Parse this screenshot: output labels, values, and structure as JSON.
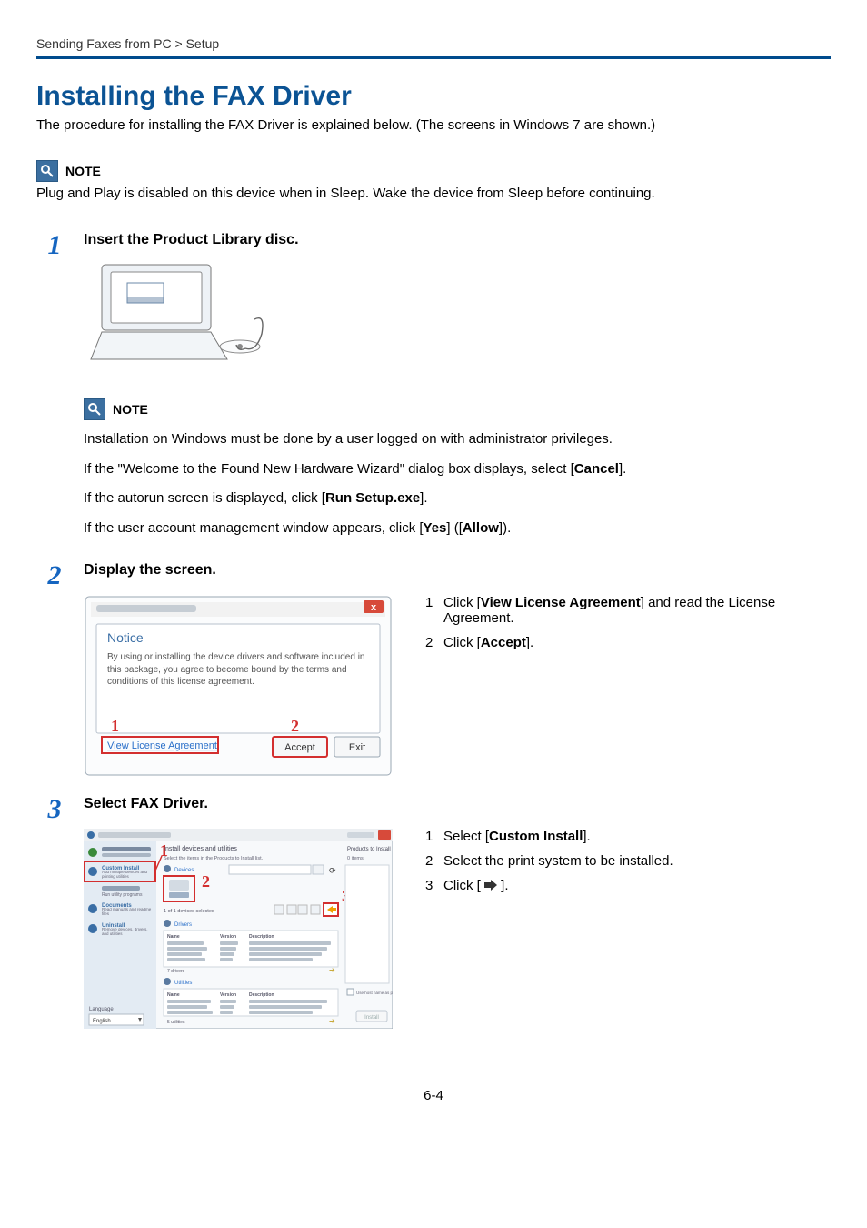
{
  "breadcrumb": "Sending Faxes from PC > Setup",
  "h1": "Installing the FAX Driver",
  "intro": "The procedure for installing the FAX Driver is explained below. (The screens in Windows 7 are shown.)",
  "note_label": "NOTE",
  "note_top": "Plug and Play is disabled on this device when in Sleep. Wake the device from Sleep before continuing.",
  "step1": {
    "num": "1",
    "head_prefix": "Insert the",
    "head_bold": " Product Library disc",
    "head_suffix": "."
  },
  "inner_note_label": "NOTE",
  "inner1": "Installation on Windows must be done by a user logged on with administrator privileges.",
  "inner2_a": "If the \"Welcome to the Found New Hardware Wizard\" dialog box displays, select [",
  "inner2_b": "Cancel",
  "inner2_c": "].",
  "inner3_a": "If the autorun screen is displayed, click [",
  "inner3_b": "Run Setup.exe",
  "inner3_c": "].",
  "inner4_a": "If the user account management window appears, click [",
  "inner4_b": "Yes",
  "inner4_c": "] ([",
  "inner4_d": "Allow",
  "inner4_e": "]).",
  "step2": {
    "num": "2",
    "head": "Display the screen."
  },
  "dlg": {
    "title": "Notice",
    "body": "By using or installing the device drivers and software included in this package, you agree to become bound by the terms and conditions of this license agreement.",
    "link": "View License Agreement",
    "accept": "Accept",
    "exit": "Exit"
  },
  "step2_list": {
    "i1a": "Click [",
    "i1b": "View License Agreement",
    "i1c": "] and read the License Agreement.",
    "i2a": "Click [",
    "i2b": "Accept",
    "i2c": "]."
  },
  "step3": {
    "num": "3",
    "head": "Select FAX Driver."
  },
  "installer": {
    "side_custom": "Custom Install",
    "side_custom_sub": "Add multiple devices and printing utilities",
    "side_maint": "Maintenance",
    "side_maint_sub": "Run utility programs",
    "side_docs": "Documents",
    "side_docs_sub": "Read manuals and readme files",
    "side_uninstall": "Uninstall",
    "side_uninstall_sub": "Remove devices, drivers, and utilities",
    "side_lang_label": "Language",
    "side_lang_value": "English",
    "main_title": "Install devices and utilities",
    "main_sub1": "Select the items in the Products to Install list.",
    "sec_devices": "Devices",
    "dev_status": "1 of 1 devices selected",
    "sec_drivers": "Drivers",
    "col_name": "Name",
    "col_version": "Version",
    "col_desc": "Description",
    "drv_count": "7 drivers",
    "sec_utils": "Utilities",
    "util_count": "5 utilities",
    "right_title": "Products to Install",
    "right_count": "0 items",
    "right_hint": "Use host name as port name",
    "btn_install": "Install"
  },
  "step3_list": {
    "i1a": "Select [",
    "i1b": "Custom Install",
    "i1c": "].",
    "i2": "Select the print system to be installed.",
    "i3a": "Click [ ",
    "i3b": " ]."
  },
  "pageno": "6-4"
}
